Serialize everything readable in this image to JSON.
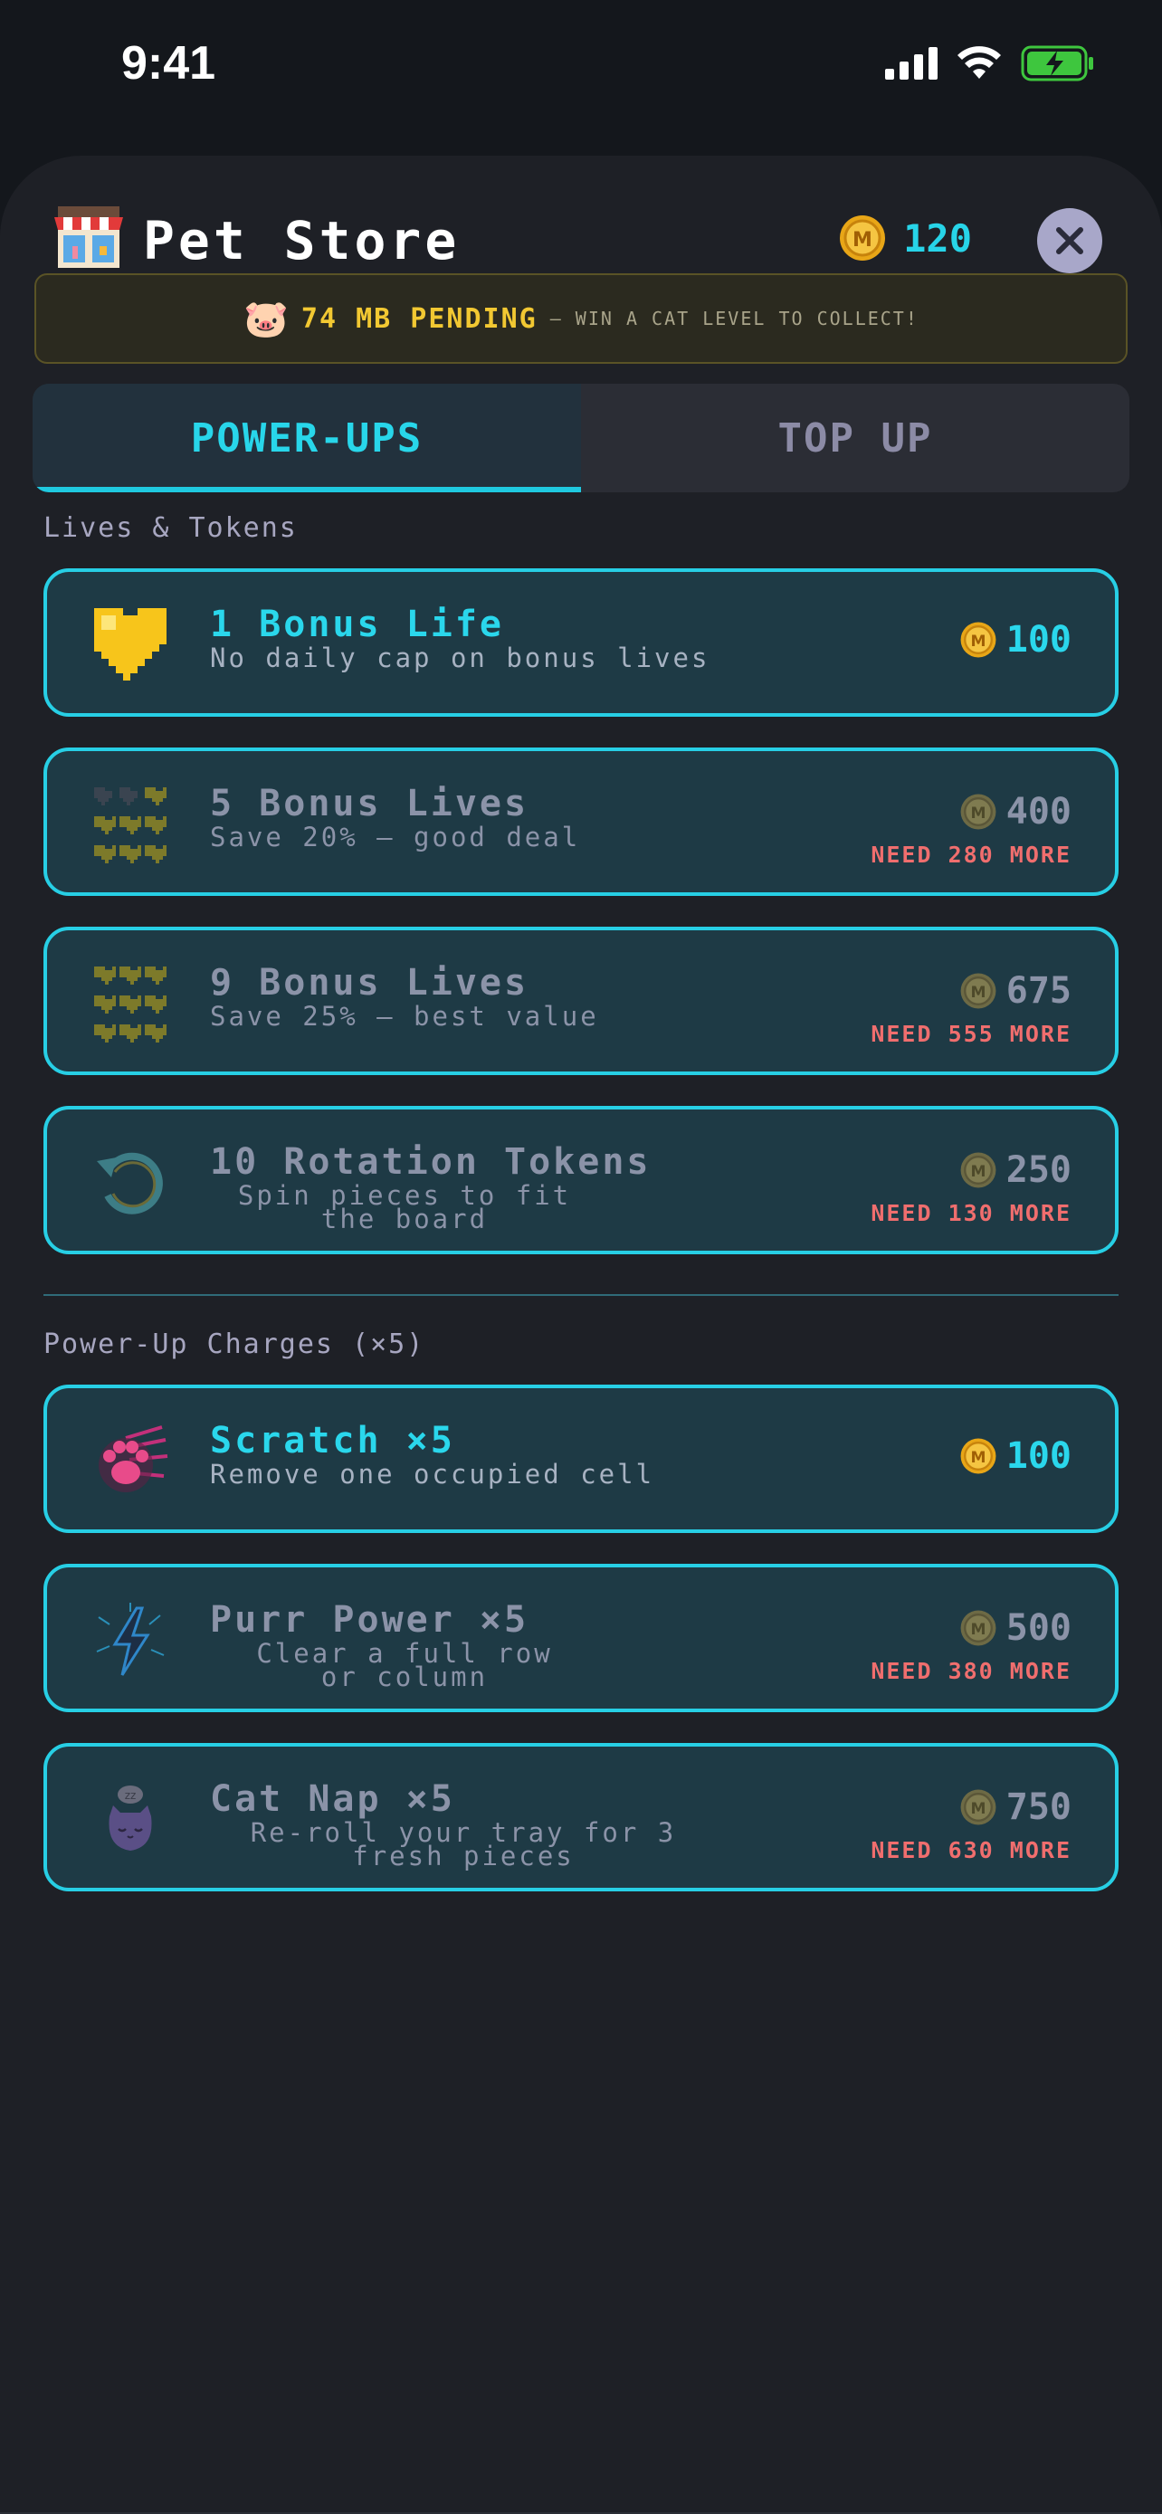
{
  "status": {
    "time": "9:41"
  },
  "header": {
    "title": "Pet Store",
    "balance": "120"
  },
  "banner": {
    "emoji": "🐷",
    "main": "74 MB PENDING",
    "sub": "— WIN A CAT LEVEL TO COLLECT!"
  },
  "tabs": [
    {
      "label": "POWER-UPS"
    },
    {
      "label": "TOP UP"
    }
  ],
  "sections": {
    "lives": "Lives & Tokens",
    "charges": "Power-Up Charges (×5)"
  },
  "items": [
    {
      "name": "1 Bonus Life",
      "desc": "No daily cap on bonus lives",
      "price": "100",
      "need": "",
      "icon": "gold-heart-icon"
    },
    {
      "name": "5 Bonus Lives",
      "desc": "Save 20% — good deal",
      "price": "400",
      "need": "NEED 280 MORE",
      "icon": "five-hearts-icon"
    },
    {
      "name": "9 Bonus Lives",
      "desc": "Save 25% — best value",
      "price": "675",
      "need": "NEED 555 MORE",
      "icon": "nine-hearts-icon"
    },
    {
      "name": "10 Rotation Tokens",
      "desc1": "Spin pieces to fit",
      "desc2": "the board",
      "price": "250",
      "need": "NEED 130 MORE",
      "icon": "rotate-icon"
    },
    {
      "name": "Scratch ×5",
      "desc": "Remove one occupied cell",
      "price": "100",
      "need": "",
      "icon": "paw-scratch-icon"
    },
    {
      "name": "Purr Power ×5",
      "desc1": "Clear a full row",
      "desc2": "or column",
      "price": "500",
      "need": "NEED 380 MORE",
      "icon": "lightning-icon"
    },
    {
      "name": "Cat Nap ×5",
      "desc1": "Re-roll your tray for 3",
      "desc2": "fresh pieces",
      "price": "750",
      "need": "NEED 630 MORE",
      "icon": "sleeping-cat-icon"
    }
  ],
  "colors": {
    "accent": "#27cfe5",
    "gold": "#f2c832",
    "warn": "#f06e6e"
  }
}
